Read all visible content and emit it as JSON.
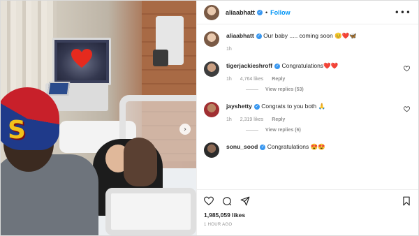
{
  "post": {
    "author": "aliaabhatt",
    "follow_label": "Follow",
    "separator": "•",
    "more_label": "•••",
    "caption_text": "Our baby ..... coming soon 😊❤️🦋",
    "caption_age": "1h",
    "likes": "1,985,059 likes",
    "time_ago": "1 HOUR AGO",
    "next_arrow": "›"
  },
  "comments": [
    {
      "user": "tigerjackieshroff",
      "text": "Congratulations❤️❤️",
      "age": "1h",
      "likes": "4,764 likes",
      "reply": "Reply",
      "view_replies": "View replies (53)"
    },
    {
      "user": "jayshetty",
      "text": "Congrats to you both 🙏",
      "age": "1h",
      "likes": "2,319 likes",
      "reply": "Reply",
      "view_replies": "View replies (6)"
    },
    {
      "user": "sonu_sood",
      "text": "Congratulations 😍😍"
    }
  ],
  "icons": {
    "verified": "✓"
  },
  "colors": {
    "accent": "#0095f6",
    "verified": "#3897f0",
    "muted": "#8e8e8e"
  }
}
